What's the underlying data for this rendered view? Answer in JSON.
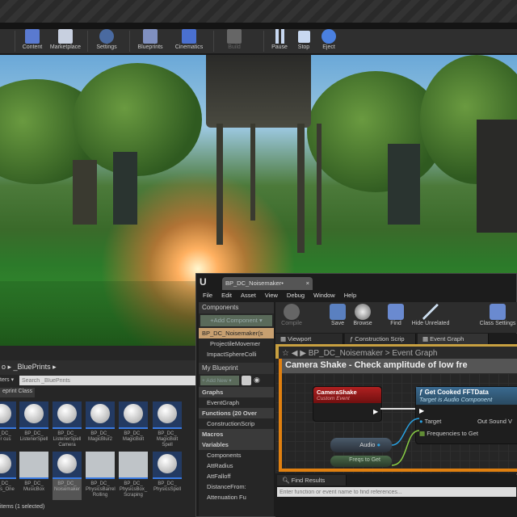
{
  "toolbar": {
    "items": [
      {
        "label": "Content",
        "icon": "content-icon",
        "color": "#5a7ad0"
      },
      {
        "label": "Marketplace",
        "icon": "marketplace-icon",
        "color": "#c8d0e0"
      },
      {
        "label": "Settings",
        "icon": "settings-icon",
        "color": "#4a6aa0"
      },
      {
        "label": "Blueprints",
        "icon": "blueprints-icon",
        "color": "#8090c0"
      },
      {
        "label": "Cinematics",
        "icon": "cinematics-icon",
        "color": "#4a70d0"
      },
      {
        "label": "Build",
        "icon": "build-icon",
        "color": "#666"
      },
      {
        "label": "Pause",
        "icon": "pause-icon",
        "color": "#c8d8f0"
      },
      {
        "label": "Stop",
        "icon": "stop-icon",
        "color": "#c8d8f0"
      },
      {
        "label": "Eject",
        "icon": "eject-icon",
        "color": "#4a80e0"
      }
    ]
  },
  "content_browser": {
    "breadcrumb": [
      "o",
      "_BluePrints"
    ],
    "filters_label": "ters ▾",
    "search_placeholder": "Search _BluePrints",
    "filter_chip": "eprint Class",
    "assets": [
      {
        "label": "BP_DC_ ener cus",
        "type": "sphere"
      },
      {
        "label": "BP_DC_ ListenerSpell",
        "type": "sphere"
      },
      {
        "label": "BP_DC_ ListenerSpell Camera",
        "type": "sphere"
      },
      {
        "label": "BP_DC_ MagicBlur2",
        "type": "sphere"
      },
      {
        "label": "BP_DC_ MagicBolt",
        "type": "sphere"
      },
      {
        "label": "BP_DC_ MagicBolt Spell",
        "type": "sphere"
      },
      {
        "label": "BP_DC_ ving ls_One",
        "type": "sphere"
      },
      {
        "label": "BP_DC_ MusicBox",
        "type": "image"
      },
      {
        "label": "BP_DC_ Noisemaker",
        "type": "sphere",
        "selected": true
      },
      {
        "label": "BP_DC_ PhysicsBarrel Rolling",
        "type": "image"
      },
      {
        "label": "BP_DC_ PhysicsBox_ Scraping",
        "type": "image"
      },
      {
        "label": "BP_DC_ PhysicsSpell",
        "type": "sphere"
      }
    ],
    "status": "items (1 selected)"
  },
  "blueprint_editor": {
    "tab_title": "BP_DC_Noisemaker•",
    "menu": [
      "File",
      "Edit",
      "Asset",
      "View",
      "Debug",
      "Window",
      "Help"
    ],
    "components": {
      "title": "Components",
      "add_button": "+Add Component ▾",
      "items": [
        "BP_DC_Noisemaker(s",
        "ProjectileMovemer",
        "ImpactSphereColli"
      ]
    },
    "toolbar": [
      {
        "label": "Compile",
        "disabled": true
      },
      {
        "label": "Save"
      },
      {
        "label": "Browse"
      },
      {
        "label": "Find"
      },
      {
        "label": "Hide Unrelated"
      },
      {
        "label": "Class Settings"
      }
    ],
    "tabs": [
      "Viewport",
      "Construction Scrip",
      "Event Graph"
    ],
    "breadcrumb": "BP_DC_Noisemaker > Event Graph",
    "my_blueprint": {
      "title": "My Blueprint",
      "add_new": "+ Add New ▾",
      "rows": [
        {
          "label": "Graphs",
          "section": true
        },
        {
          "label": "EventGraph"
        },
        {
          "label": "Functions (20 Over",
          "section": true
        },
        {
          "label": "ConstructionScrip"
        },
        {
          "label": "Macros",
          "section": true
        },
        {
          "label": "Variables",
          "section": true
        },
        {
          "label": "Components"
        },
        {
          "label": "AttRadius"
        },
        {
          "label": "AttFalloff"
        },
        {
          "label": "DistanceFrom:"
        },
        {
          "label": "Attenuation Fu"
        }
      ]
    },
    "graph": {
      "comment": "Camera Shake - Check amplitude of low fre",
      "event_node": {
        "title": "CameraShake",
        "subtitle": "Custom Event"
      },
      "function_node": {
        "title": "Get Cooked FFTData",
        "subtitle": "Target is Audio Component",
        "pins": [
          "Target",
          "Frequencies to Get",
          "Out Sound V"
        ]
      },
      "audio_var": "Audio",
      "freqs_var": "Freqs to Get"
    },
    "find_results": {
      "title": "Find Results",
      "placeholder": "Enter function or event name to find references..."
    }
  }
}
